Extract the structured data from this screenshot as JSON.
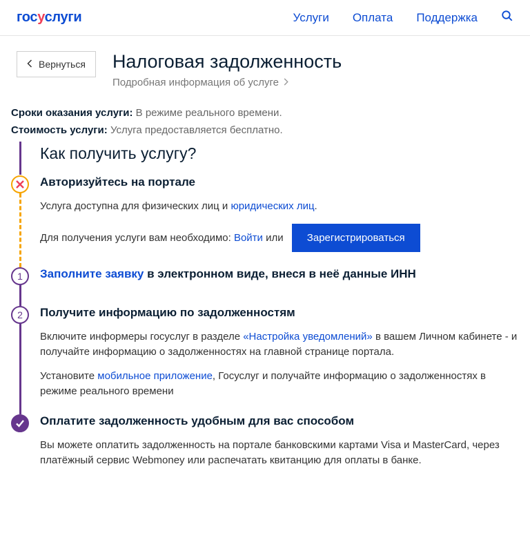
{
  "header": {
    "logo_parts": [
      "гос",
      "у",
      "слуги"
    ],
    "nav": [
      "Услуги",
      "Оплата",
      "Поддержка"
    ]
  },
  "back": "Вернуться",
  "title": "Налоговая задолженность",
  "subinfo": "Подробная информация об услуге",
  "facts": {
    "timing_label": "Сроки оказания услуги:",
    "timing_value": "В режиме реального времени.",
    "cost_label": "Стоимость услуги:",
    "cost_value": "Услуга предоставляется бесплатно."
  },
  "how_title": "Как получить услугу?",
  "steps": {
    "s1": {
      "title": "Авторизуйтесь на портале",
      "p1_a": "Услуга доступна для физических лиц и ",
      "p1_link": "юридических лиц",
      "p1_b": ".",
      "p2_a": "Для получения услуги вам необходимо: ",
      "p2_link": "Войти",
      "p2_b": " или",
      "btn": "Зарегистрироваться"
    },
    "s2": {
      "title_link": "Заполните заявку",
      "title_rest": " в электронном виде, внеся в неё данные ИНН",
      "num": "1"
    },
    "s3": {
      "title": "Получите информацию по задолженностям",
      "num": "2",
      "p1_a": "Включите информеры госуслуг в разделе ",
      "p1_link": "«Настройка уведомлений»",
      "p1_b": " в вашем Личном кабинете - и получайте информацию о задолженностях на главной странице портала.",
      "p2_a": "Установите ",
      "p2_link": "мобильное приложение",
      "p2_b": ", Госуслуг и получайте информацию о задолженностях в режиме реального времени"
    },
    "s4": {
      "title": "Оплатите задолженность удобным для вас способом",
      "p1": "Вы можете оплатить задолженность на портале банковскими картами Visa и MasterCard, через платёжный сервис Webmoney или распечатать квитанцию для оплаты в банке."
    }
  }
}
